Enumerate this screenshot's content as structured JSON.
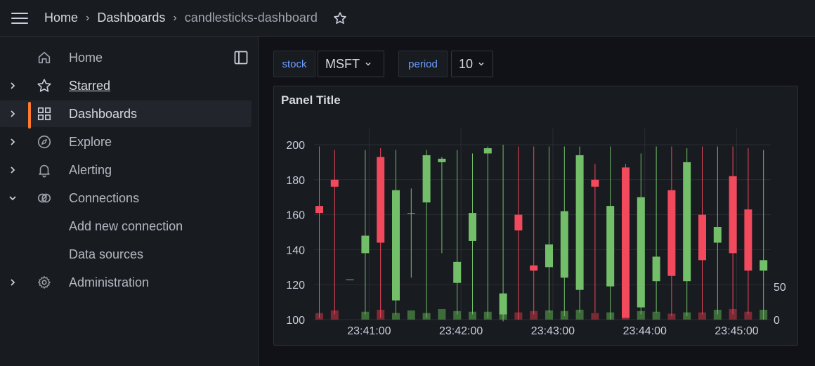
{
  "breadcrumb": {
    "items": [
      "Home",
      "Dashboards",
      "candlesticks-dashboard"
    ]
  },
  "sidebar": {
    "items": [
      {
        "label": "Home",
        "icon": "home-icon",
        "expand": "none"
      },
      {
        "label": "Starred",
        "icon": "star-icon",
        "expand": "collapsed"
      },
      {
        "label": "Dashboards",
        "icon": "grid-icon",
        "expand": "collapsed",
        "active": true
      },
      {
        "label": "Explore",
        "icon": "compass-icon",
        "expand": "collapsed"
      },
      {
        "label": "Alerting",
        "icon": "bell-icon",
        "expand": "collapsed"
      },
      {
        "label": "Connections",
        "icon": "connections-icon",
        "expand": "expanded"
      },
      {
        "label": "Add new connection",
        "icon": "",
        "expand": "none"
      },
      {
        "label": "Data sources",
        "icon": "",
        "expand": "none"
      },
      {
        "label": "Administration",
        "icon": "cog-icon",
        "expand": "collapsed"
      }
    ]
  },
  "variables": {
    "stock": {
      "label": "stock",
      "value": "MSFT"
    },
    "period": {
      "label": "period",
      "value": "10"
    }
  },
  "panel": {
    "title": "Panel Title"
  },
  "colors": {
    "up": "#73bf69",
    "down": "#f2495c",
    "up_volume": "#3d6b3a",
    "down_volume": "#7a2a35",
    "accent": "#ff7a2e",
    "variable_label": "#6e9fff"
  },
  "chart_data": {
    "type": "candlestick",
    "title": "Panel Title",
    "y_ticks": [
      100,
      120,
      140,
      160,
      180,
      200
    ],
    "ylim": [
      90,
      200
    ],
    "y2_ticks": [
      0,
      50
    ],
    "y2lim": [
      0,
      100
    ],
    "x_ticks": [
      "23:41:00",
      "23:42:00",
      "23:43:00",
      "23:44:00",
      "23:45:00"
    ],
    "x_tick_index": [
      3.25,
      9.25,
      15.25,
      21.25,
      27.25
    ],
    "grid": true,
    "candles": [
      {
        "open": 165,
        "close": 161,
        "high": 199,
        "low": 101,
        "volume": 10
      },
      {
        "open": 180,
        "close": 176,
        "high": 197,
        "low": 103,
        "volume": 14
      },
      {
        "open": 123,
        "close": 123,
        "high": 123,
        "low": 123,
        "volume": 0
      },
      {
        "open": 138,
        "close": 148,
        "high": 197,
        "low": 103,
        "volume": 12
      },
      {
        "open": 193,
        "close": 144,
        "high": 198,
        "low": 101,
        "volume": 15
      },
      {
        "open": 111,
        "close": 174,
        "high": 197,
        "low": 103,
        "volume": 10
      },
      {
        "open": 161,
        "close": 161,
        "high": 175,
        "low": 124,
        "volume": 14
      },
      {
        "open": 167,
        "close": 194,
        "high": 197,
        "low": 101,
        "volume": 10
      },
      {
        "open": 190,
        "close": 192,
        "high": 193,
        "low": 138,
        "volume": 16
      },
      {
        "open": 121,
        "close": 133,
        "high": 197,
        "low": 103,
        "volume": 13
      },
      {
        "open": 145,
        "close": 161,
        "high": 195,
        "low": 103,
        "volume": 12
      },
      {
        "open": 195,
        "close": 198,
        "high": 199,
        "low": 101,
        "volume": 12
      },
      {
        "open": 103,
        "close": 115,
        "high": 200,
        "low": 99,
        "volume": 14
      },
      {
        "open": 160,
        "close": 151,
        "high": 199,
        "low": 100,
        "volume": 11
      },
      {
        "open": 131,
        "close": 128,
        "high": 199,
        "low": 103,
        "volume": 13
      },
      {
        "open": 130,
        "close": 143,
        "high": 199,
        "low": 104,
        "volume": 14
      },
      {
        "open": 124,
        "close": 162,
        "high": 199,
        "low": 102,
        "volume": 13
      },
      {
        "open": 117,
        "close": 194,
        "high": 199,
        "low": 104,
        "volume": 15
      },
      {
        "open": 180,
        "close": 176,
        "high": 189,
        "low": 104,
        "volume": 10
      },
      {
        "open": 119,
        "close": 165,
        "high": 199,
        "low": 100,
        "volume": 11
      },
      {
        "open": 187,
        "close": 101,
        "high": 189,
        "low": 101,
        "volume": 11
      },
      {
        "open": 107,
        "close": 170,
        "high": 195,
        "low": 103,
        "volume": 13
      },
      {
        "open": 122,
        "close": 136,
        "high": 199,
        "low": 104,
        "volume": 12
      },
      {
        "open": 174,
        "close": 125,
        "high": 199,
        "low": 102,
        "volume": 9
      },
      {
        "open": 122,
        "close": 190,
        "high": 198,
        "low": 102,
        "volume": 11
      },
      {
        "open": 160,
        "close": 134,
        "high": 199,
        "low": 103,
        "volume": 11
      },
      {
        "open": 144,
        "close": 153,
        "high": 199,
        "low": 103,
        "volume": 15
      },
      {
        "open": 182,
        "close": 138,
        "high": 199,
        "low": 103,
        "volume": 16
      },
      {
        "open": 163,
        "close": 128,
        "high": 198,
        "low": 103,
        "volume": 12
      },
      {
        "open": 128,
        "close": 134,
        "high": 197,
        "low": 100,
        "volume": 15
      }
    ]
  }
}
